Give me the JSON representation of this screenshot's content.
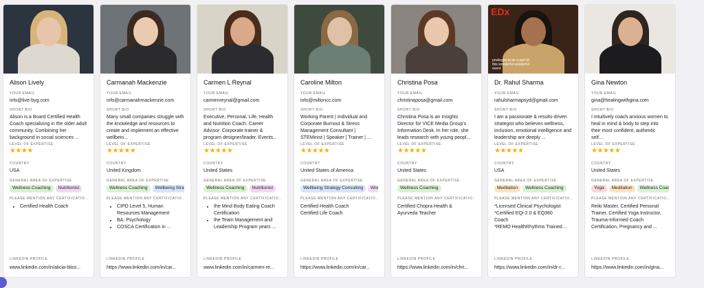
{
  "labels": {
    "email": "YOUR EMAIL",
    "bio": "SHORT BIO",
    "expertise_level": "LEVEL OF EXPERTISE",
    "country": "COUNTRY",
    "area": "GENERAL AREA OF EXPERTISE",
    "certs": "PLEASE MENTION ANY CERTIFICATIO...",
    "linkedin": "LINKEDIN PROFILE"
  },
  "colors": {
    "star": "#f2b20c",
    "tag_green_bg": "#d9f2d2",
    "tag_blue_bg": "#d8e4fb",
    "tag_purple_bg": "#f1d9f3",
    "tag_orange_bg": "#fde3c4",
    "tag_pink_bg": "#fbd7d9"
  },
  "cards": [
    {
      "name": "Alison Lively",
      "email": "info@live-byg.com",
      "bio": "Alison is a Board Certified Health Coach specializing in the older adult community. Combining her background in social sciences ...",
      "stars": "★★★★",
      "country": "USA",
      "tags": [
        {
          "label": "Wellness Coaching",
          "color": "green"
        },
        {
          "label": "Nutritionist",
          "color": "purple"
        }
      ],
      "certs_type": "list",
      "certs": [
        "Certified Health Coach"
      ],
      "linkedin": "www.linkedin.com/in/alicia-bliss...",
      "photo": {
        "bg": "#2c3440",
        "skin": "#e8c4a8",
        "hair": "#d6b47a",
        "shirt": "#ddd8d0"
      }
    },
    {
      "name": "Carmanah Mackenzie",
      "email": "info@carmanahmackenzie.com",
      "bio": "Many small companies struggle with the knowledge and resources to create and implement an effective wellbein...",
      "stars": "★★★★★",
      "country": "United Kingdom",
      "tags": [
        {
          "label": "Wellness Coaching",
          "color": "green"
        },
        {
          "label": "Wellbeing Strategy",
          "color": "blue"
        }
      ],
      "certs_type": "list",
      "certs": [
        "CIPD Level 5, Human Resources Management",
        "BA, Psychology",
        "COSCA Certification in ..."
      ],
      "linkedin": "https://www.linkedin.com/in/car...",
      "photo": {
        "bg": "#6e7378",
        "skin": "#eccab0",
        "hair": "#3a2a20",
        "shirt": "#2b2b2e"
      }
    },
    {
      "name": "Carmen L Reynal",
      "email": "carmenreynal@gmail.com",
      "bio": "Executive, Personal, Life, Health and Nutrition Coach. Career Advisor. Corporate trainer & program designer/leader. Events...",
      "stars": "★★★★★",
      "country": "United States",
      "tags": [
        {
          "label": "Wellness Coaching",
          "color": "green"
        },
        {
          "label": "Nutritionist",
          "color": "purple"
        }
      ],
      "certs_type": "list",
      "certs": [
        "the Mind Body Eating Coach Certification",
        "the Team Management and Leadership Program years ..."
      ],
      "linkedin": "www.linkedin.com/in/carmen-re...",
      "photo": {
        "bg": "#d9d4c8",
        "skin": "#d9a98a",
        "hair": "#4a2c1c",
        "shirt": "#2c2b30"
      }
    },
    {
      "name": "Caroline Milton",
      "email": "info@miltoncc.com",
      "bio": "Working Parent | Individual and Corporate Burnout & Stress Management Consultant | STEMinist | Speaker | Trainer | ...",
      "stars": "★★★★★",
      "country": "United States of America",
      "tags": [
        {
          "label": "Wellbeing Strategy Consulting",
          "color": "blue"
        },
        {
          "label": "Workshop",
          "color": "purple"
        }
      ],
      "certs_type": "text",
      "certs": [
        "Certified Health Coach",
        "Certified Life Coach"
      ],
      "linkedin": "https://www.linkedin.com/in/car...",
      "photo": {
        "bg": "#3f4a3e",
        "skin": "#e1c1a5",
        "hair": "#8a6a44",
        "shirt": "#6b7f74"
      }
    },
    {
      "name": "Christina Posa",
      "email": "christinaposa@gmail.com",
      "bio": "Christina Posa is an Insights Director for VICE Media Group's Information Desk. In her role, she leads research with young peopl...",
      "stars": "★★★★★",
      "country": "United States",
      "tags": [
        {
          "label": "Wellness Coaching",
          "color": "green"
        }
      ],
      "certs_type": "text",
      "certs": [
        "Certified Chopra Health &",
        "Ayurveda Teacher"
      ],
      "linkedin": "https://www.linkedin.com/in/chri...",
      "photo": {
        "bg": "#8a8580",
        "skin": "#eac8ae",
        "hair": "#5a3a26",
        "shirt": "#4a3f3a"
      }
    },
    {
      "name": "Dr. Rahul Sharma",
      "email": "rahulsharmapsyd@gmail.com",
      "bio": "I am a passionate & results-driven strategist who believes wellness, inclusion, emotional intelligence and leadership are deeply ...",
      "stars": "★★★★★",
      "country": "USA",
      "tags": [
        {
          "label": "Meditation",
          "color": "orange"
        },
        {
          "label": "Wellness Coaching",
          "color": "green"
        }
      ],
      "certs_type": "text",
      "certs": [
        "*Licensed Clinical Psychologist",
        "*Certified EQi-2.0 & EQ360",
        "Coach",
        "*REMO HealthRhythms Trained ..."
      ],
      "linkedin": "https://www.linkedin.com/in/dr-r...",
      "photo": {
        "bg": "#3a2418",
        "skin": "#a6714f",
        "hair": "#1a1410",
        "shirt": "#c9a46a"
      },
      "caption": "privileged to be a part of this wonderful wonderful event",
      "logo": "EDx"
    },
    {
      "name": "Gina Newton",
      "email": "gina@healingwithgina.com",
      "bio": "I intuitively coach anxious women to heal in mind & body to step into their most confident, authentic self....",
      "stars": "★★★★★",
      "country": "United States",
      "tags": [
        {
          "label": "Yoga",
          "color": "pink"
        },
        {
          "label": "Meditation",
          "color": "orange"
        },
        {
          "label": "Wellness Coaching",
          "color": "green"
        }
      ],
      "certs_type": "text",
      "certs": [
        "Reiki Master, Certified Personal Trainer, Certified Yoga Instructor, Trauma-Informed Coach Certification, Pregnancy and ..."
      ],
      "linkedin": "https://www.linkedin.com/in/gina...",
      "photo": {
        "bg": "#eae7e3",
        "skin": "#dcb192",
        "hair": "#2e2520",
        "shirt": "#1c1c1e"
      }
    }
  ]
}
